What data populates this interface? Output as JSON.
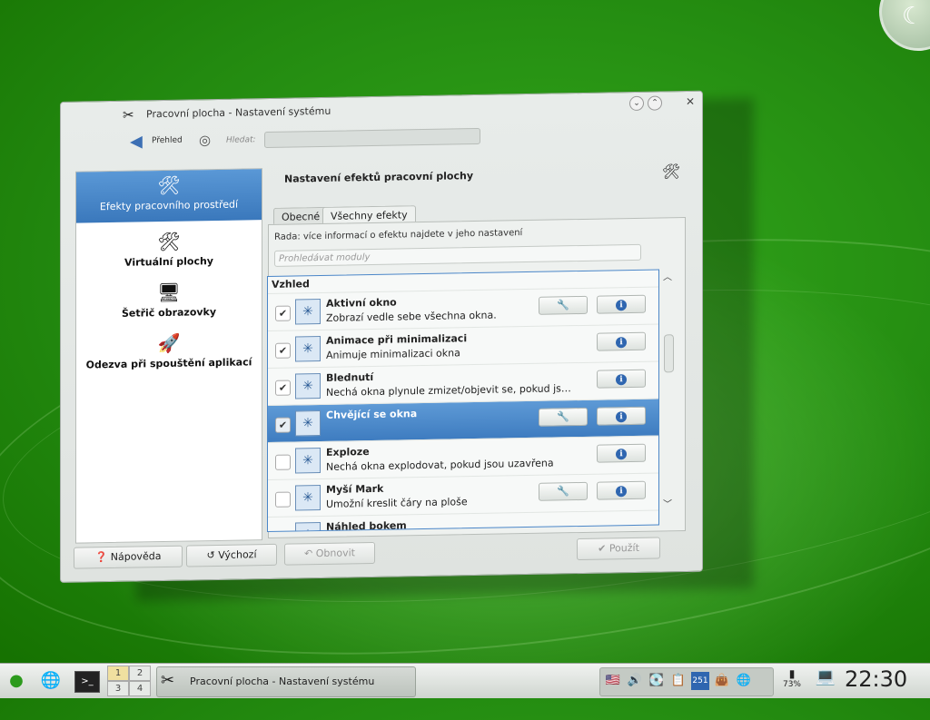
{
  "window": {
    "title": "Pracovní plocha - Nastavení systému",
    "toolbar": {
      "back_label": "Přehled",
      "search_label": "Hledat:"
    },
    "sidebar": [
      {
        "label": "Efekty pracovního prostředí",
        "icon": "desktop-effects-icon"
      },
      {
        "label": "Virtuální plochy",
        "icon": "virtual-desktops-icon"
      },
      {
        "label": "Šetřič obrazovky",
        "icon": "screensaver-icon"
      },
      {
        "label": "Odezva při spouštění aplikací",
        "icon": "rocket-icon"
      }
    ],
    "pane_title": "Nastavení efektů pracovní plochy",
    "tabs": [
      "Obecné",
      "Všechny efekty"
    ],
    "hint": "Rada: více informací o efektu najdete v jeho nastavení",
    "filter_placeholder": "Prohledávat moduly",
    "group": "Vzhled",
    "effects": [
      {
        "name": "Aktivní okno",
        "desc": "Zobrazí vedle sebe všechna okna.",
        "checked": true,
        "config": true
      },
      {
        "name": "Animace při minimalizaci",
        "desc": "Animuje minimalizaci okna",
        "checked": true,
        "config": false
      },
      {
        "name": "Blednutí",
        "desc": "Nechá okna plynule zmizet/objevit se, pokud js…",
        "checked": true,
        "config": false
      },
      {
        "name": "Chvějící se okna",
        "desc": "",
        "checked": true,
        "config": true
      },
      {
        "name": "Exploze",
        "desc": "Nechá okna explodovat, pokud jsou uzavřena",
        "checked": false,
        "config": false
      },
      {
        "name": "Myší Mark",
        "desc": "Umožní kreslit čáry na ploše",
        "checked": false,
        "config": true
      },
      {
        "name": "Náhled bokem",
        "desc": "",
        "checked": false,
        "config": false
      }
    ],
    "buttons": {
      "help": "Nápověda",
      "defaults": "Výchozí",
      "reset": "Obnovit",
      "apply": "Použít"
    }
  },
  "taskbar": {
    "pager": [
      "1",
      "2",
      "3",
      "4"
    ],
    "task_title": "Pracovní plocha - Nastavení systému",
    "tray_count": "251",
    "battery": "73%",
    "clock": "22:30"
  }
}
